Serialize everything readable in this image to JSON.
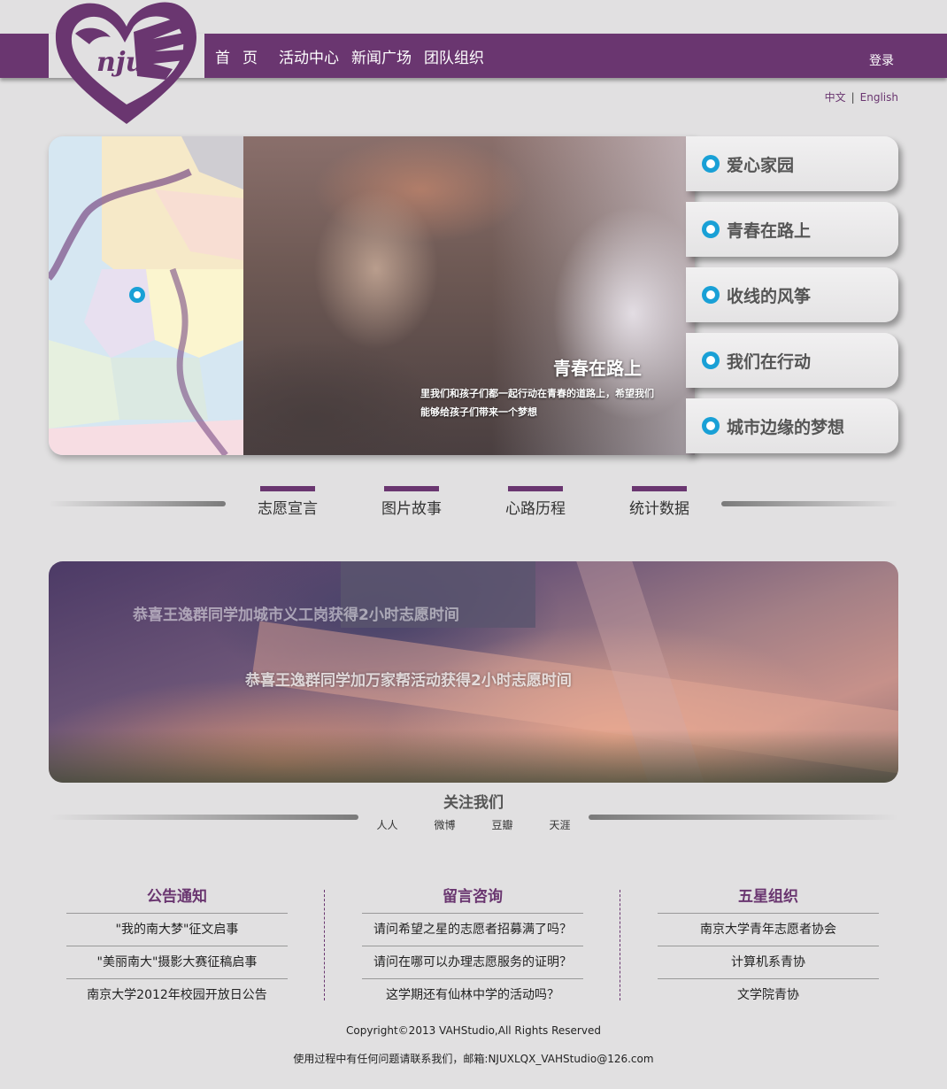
{
  "header": {
    "logo_text": "nju",
    "nav": [
      "首页",
      "活动中心",
      "新闻广场",
      "团队组织"
    ],
    "login": "登录",
    "lang": {
      "zh": "中文",
      "sep": "|",
      "en": "English"
    }
  },
  "hero": {
    "slide_title": "青春在路上",
    "slide_desc": "里我们和孩子们都一起行动在青春的道路上，希望我们能够给孩子们带来一个梦想",
    "items": [
      "爱心家园",
      "青春在路上",
      "收线的风筝",
      "我们在行动",
      "城市边缘的梦想"
    ]
  },
  "tabs": [
    "志愿宣言",
    "图片故事",
    "心路历程",
    "统计数据"
  ],
  "banner": {
    "line1": "恭喜王逸群同学加城市义工岗获得2小时志愿时间",
    "line2": "恭喜王逸群同学加万家帮活动获得2小时志愿时间"
  },
  "follow": {
    "title": "关注我们",
    "links": [
      "人人",
      "微博",
      "豆瓣",
      "天涯"
    ]
  },
  "columns": [
    {
      "title": "公告通知",
      "rows": [
        "\"我的南大梦\"征文启事",
        "\"美丽南大\"摄影大赛征稿启事",
        "南京大学2012年校园开放日公告"
      ]
    },
    {
      "title": "留言咨询",
      "rows": [
        "请问希望之星的志愿者招募满了吗？",
        "请问在哪可以办理志愿服务的证明？",
        "这学期还有仙林中学的活动吗？"
      ]
    },
    {
      "title": "五星组织",
      "rows": [
        "南京大学青年志愿者协会",
        "计算机系青协",
        "文学院青协"
      ]
    }
  ],
  "footer": {
    "copyright": "Copyright©2013 VAHStudio,All Rights Reserved",
    "contact": "使用过程中有任何问题请联系我们，邮箱:NJUXLQX_VAHStudio@126.com"
  },
  "colors": {
    "brand": "#6a3670",
    "accent": "#19a0d6",
    "background": "#e1e0e1"
  }
}
